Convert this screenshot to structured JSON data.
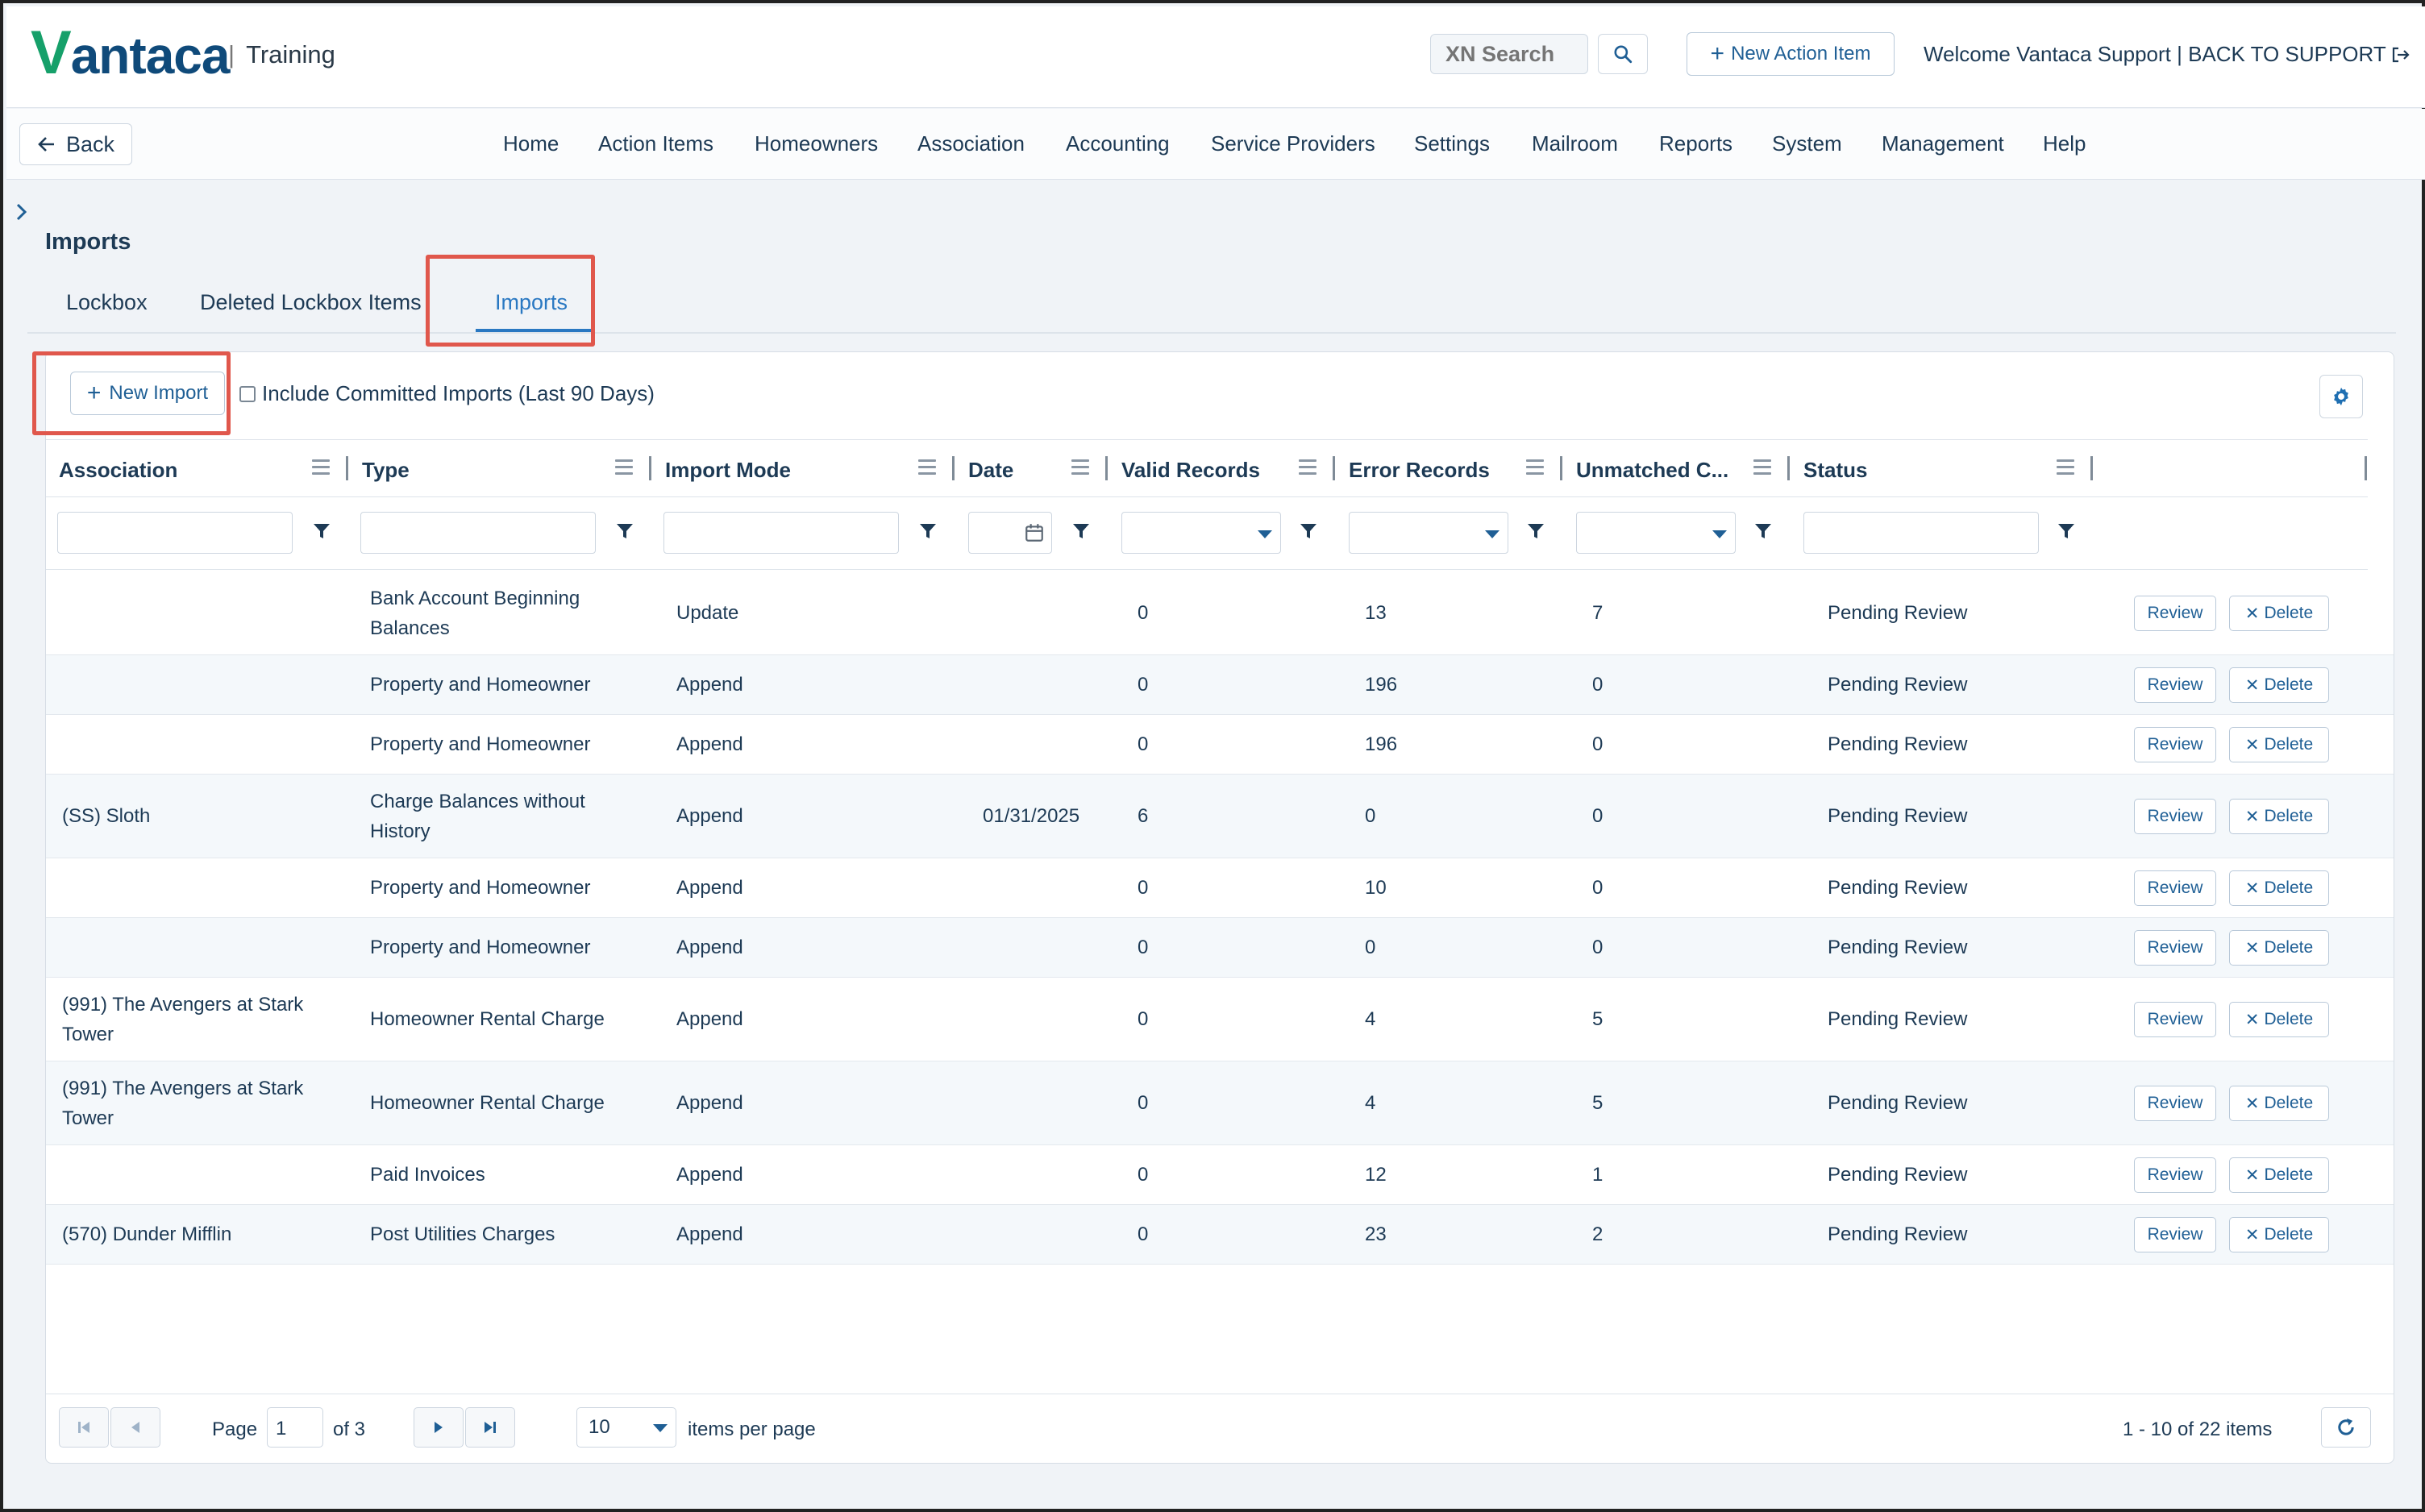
{
  "header": {
    "logo_prefix": "V",
    "logo_rest": "antaca",
    "environment": "Training",
    "search_placeholder": "XN Search",
    "new_action_label": "New Action Item",
    "welcome_text": "Welcome Vantaca Support | BACK TO SUPPORT"
  },
  "nav": {
    "back_label": "Back",
    "items": [
      "Home",
      "Action Items",
      "Homeowners",
      "Association",
      "Accounting",
      "Service Providers",
      "Settings",
      "Mailroom",
      "Reports",
      "System",
      "Management",
      "Help"
    ]
  },
  "page": {
    "title": "Imports",
    "tabs": [
      "Lockbox",
      "Deleted Lockbox Items",
      "Imports"
    ],
    "active_tab": "Imports"
  },
  "toolbar": {
    "new_import_label": "New Import",
    "include_committed_label": "Include Committed Imports (Last 90 Days)"
  },
  "grid": {
    "columns": [
      "Association",
      "Type",
      "Import Mode",
      "Date",
      "Valid Records",
      "Error Records",
      "Unmatched C...",
      "Status"
    ],
    "review_label": "Review",
    "delete_label": "Delete",
    "rows": [
      {
        "association": "",
        "type": "Bank Account Beginning Balances",
        "mode": "Update",
        "date": "",
        "valid": "0",
        "error": "13",
        "unmatched": "7",
        "status": "Pending Review"
      },
      {
        "association": "",
        "type": "Property and Homeowner",
        "mode": "Append",
        "date": "",
        "valid": "0",
        "error": "196",
        "unmatched": "0",
        "status": "Pending Review"
      },
      {
        "association": "",
        "type": "Property and Homeowner",
        "mode": "Append",
        "date": "",
        "valid": "0",
        "error": "196",
        "unmatched": "0",
        "status": "Pending Review"
      },
      {
        "association": "(SS) Sloth",
        "type": "Charge Balances without History",
        "mode": "Append",
        "date": "01/31/2025",
        "valid": "6",
        "error": "0",
        "unmatched": "0",
        "status": "Pending Review"
      },
      {
        "association": "",
        "type": "Property and Homeowner",
        "mode": "Append",
        "date": "",
        "valid": "0",
        "error": "10",
        "unmatched": "0",
        "status": "Pending Review"
      },
      {
        "association": "",
        "type": "Property and Homeowner",
        "mode": "Append",
        "date": "",
        "valid": "0",
        "error": "0",
        "unmatched": "0",
        "status": "Pending Review"
      },
      {
        "association": "(991) The Avengers at Stark Tower",
        "type": "Homeowner Rental Charge",
        "mode": "Append",
        "date": "",
        "valid": "0",
        "error": "4",
        "unmatched": "5",
        "status": "Pending Review"
      },
      {
        "association": "(991) The Avengers at Stark Tower",
        "type": "Homeowner Rental Charge",
        "mode": "Append",
        "date": "",
        "valid": "0",
        "error": "4",
        "unmatched": "5",
        "status": "Pending Review"
      },
      {
        "association": "",
        "type": "Paid Invoices",
        "mode": "Append",
        "date": "",
        "valid": "0",
        "error": "12",
        "unmatched": "1",
        "status": "Pending Review"
      },
      {
        "association": "(570) Dunder Mifflin",
        "type": "Post Utilities Charges",
        "mode": "Append",
        "date": "",
        "valid": "0",
        "error": "23",
        "unmatched": "2",
        "status": "Pending Review"
      }
    ]
  },
  "pager": {
    "page_label": "Page",
    "current_page": "1",
    "of_label": "of 3",
    "page_size": "10",
    "per_page_label": "items per page",
    "summary": "1 - 10 of 22 items"
  },
  "colors": {
    "brand_navy": "#0f4a7a",
    "brand_green": "#16a06a",
    "accent_blue": "#2a78c2",
    "highlight_red": "#e0574c"
  }
}
